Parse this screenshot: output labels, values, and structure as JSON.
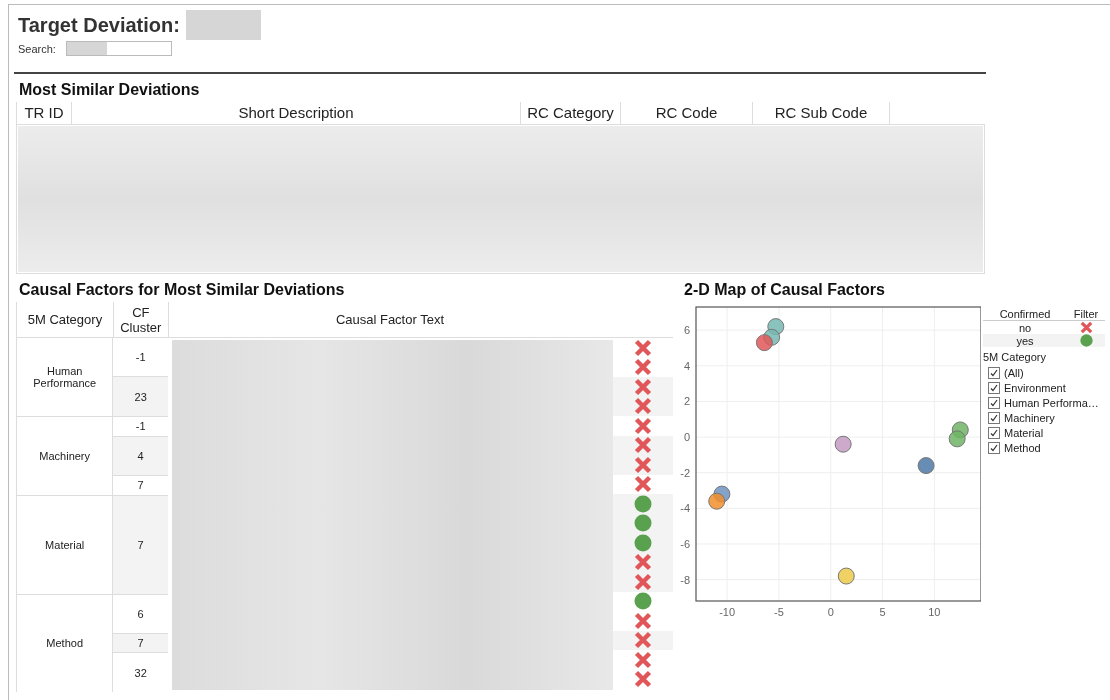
{
  "header": {
    "title": "Target Deviation:",
    "search_label": "Search:"
  },
  "similar": {
    "title": "Most Similar Deviations",
    "columns": [
      "TR ID",
      "Short Description",
      "RC Category",
      "RC Code",
      "RC Sub Code"
    ]
  },
  "causal": {
    "title": "Causal Factors for Most Similar Deviations",
    "columns": [
      "5M Category",
      "CF Cluster",
      "Causal Factor Text"
    ],
    "categories": [
      {
        "name": "Human Performance",
        "clusters": [
          {
            "cluster": "-1",
            "rows": [
              {
                "confirmed": false
              },
              {
                "confirmed": false
              }
            ]
          },
          {
            "cluster": "23",
            "rows": [
              {
                "confirmed": false
              },
              {
                "confirmed": false
              }
            ]
          }
        ]
      },
      {
        "name": "Machinery",
        "clusters": [
          {
            "cluster": "-1",
            "rows": [
              {
                "confirmed": false
              }
            ]
          },
          {
            "cluster": "4",
            "rows": [
              {
                "confirmed": false
              },
              {
                "confirmed": false
              }
            ]
          },
          {
            "cluster": "7",
            "rows": [
              {
                "confirmed": false
              }
            ]
          }
        ]
      },
      {
        "name": "Material",
        "clusters": [
          {
            "cluster": "7",
            "rows": [
              {
                "confirmed": true
              },
              {
                "confirmed": true
              },
              {
                "confirmed": true
              },
              {
                "confirmed": false
              },
              {
                "confirmed": false
              }
            ]
          }
        ]
      },
      {
        "name": "Method",
        "clusters": [
          {
            "cluster": "6",
            "rows": [
              {
                "confirmed": true
              },
              {
                "confirmed": false
              }
            ]
          },
          {
            "cluster": "7",
            "rows": [
              {
                "confirmed": false
              }
            ]
          },
          {
            "cluster": "32",
            "rows": [
              {
                "confirmed": false
              },
              {
                "confirmed": false
              }
            ]
          }
        ]
      }
    ]
  },
  "map": {
    "title": "2-D Map of Causal Factors",
    "chart_data": {
      "type": "scatter",
      "grid": true,
      "xlim": [
        -13,
        14.5
      ],
      "ylim": [
        -9.2,
        7.3
      ],
      "xticks": [
        -10,
        -5,
        0,
        5,
        10
      ],
      "yticks": [
        -8,
        -6,
        -4,
        -2,
        0,
        2,
        4,
        6
      ],
      "series": [
        {
          "color": "#76b7b2",
          "x": [
            -5.3,
            -5.7
          ],
          "values": [
            6.2,
            5.6
          ]
        },
        {
          "color": "#e15759",
          "x": [
            -6.4
          ],
          "values": [
            5.3
          ]
        },
        {
          "color": "#6f93bf",
          "x": [
            -10.5
          ],
          "values": [
            -3.2
          ]
        },
        {
          "color": "#f28e2b",
          "x": [
            -11
          ],
          "values": [
            -3.6
          ]
        },
        {
          "color": "#c49bc3",
          "x": [
            1.2
          ],
          "values": [
            -0.4
          ]
        },
        {
          "color": "#4e79a7",
          "x": [
            9.2
          ],
          "values": [
            -1.6
          ]
        },
        {
          "color": "#6fb565",
          "x": [
            12.5,
            12.2
          ],
          "values": [
            0.4,
            -0.1
          ]
        },
        {
          "color": "#edc948",
          "x": [
            1.5
          ],
          "values": [
            -7.8
          ]
        }
      ]
    }
  },
  "legend": {
    "columns": [
      "Confirmed",
      "Filter"
    ],
    "items": [
      {
        "label": "no",
        "confirmed": false
      },
      {
        "label": "yes",
        "confirmed": true
      }
    ]
  },
  "filter": {
    "title": "5M Category",
    "options": [
      {
        "label": "(All)",
        "checked": true
      },
      {
        "label": "Environment",
        "checked": true
      },
      {
        "label": "Human Performa…",
        "checked": true
      },
      {
        "label": "Machinery",
        "checked": true
      },
      {
        "label": "Material",
        "checked": true
      },
      {
        "label": "Method",
        "checked": true
      }
    ]
  }
}
